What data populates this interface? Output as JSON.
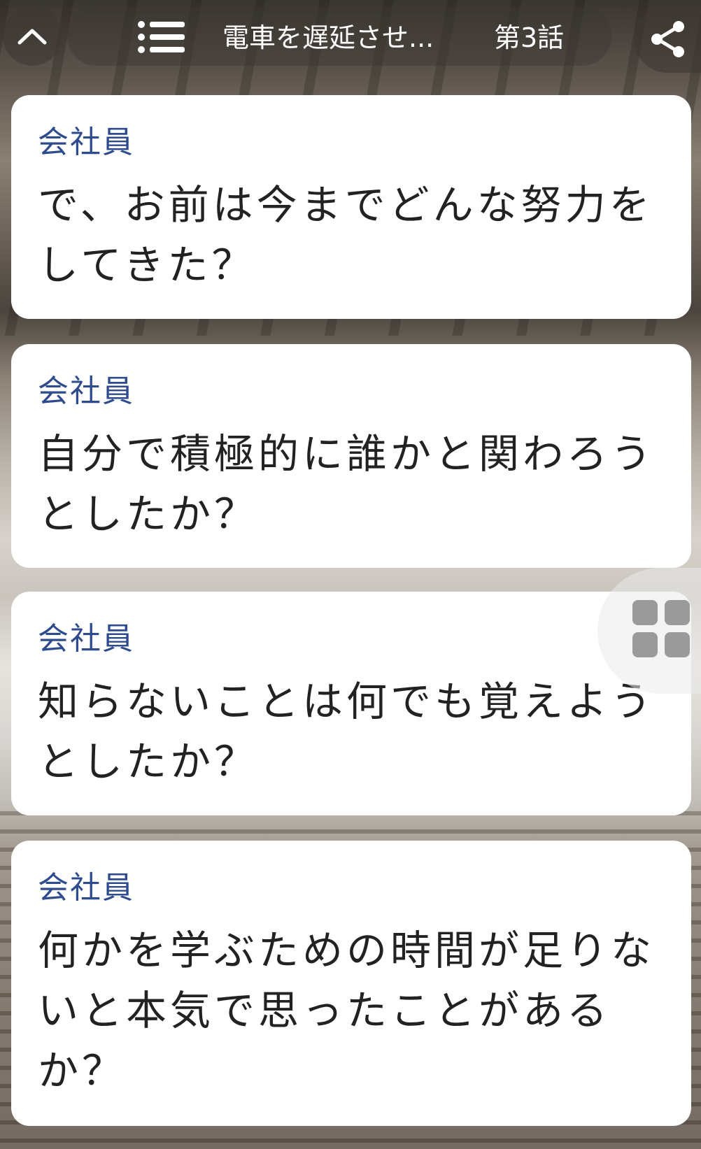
{
  "header": {
    "back_icon": "chevron-up-icon",
    "menu_icon": "list-icon",
    "title": "電車を遅延させ...",
    "episode": "第3話",
    "share_icon": "share-icon"
  },
  "colors": {
    "speaker": "#2e4c8d",
    "message_text": "#222222",
    "card_bg": "#ffffff",
    "header_pill": "rgba(60,55,50,0.45)"
  },
  "messages": [
    {
      "speaker": "会社員",
      "text": "で、お前は今までどんな努力を\nしてきた？"
    },
    {
      "speaker": "会社員",
      "text": "自分で積極的に誰かと関わろう\nとしたか？"
    },
    {
      "speaker": "会社員",
      "text": "知らないことは何でも覚えよう\nとしたか？"
    },
    {
      "speaker": "会社員",
      "text": "何かを学ぶための時間が足りな\nいと本気で思ったことがある\nか？"
    }
  ],
  "floating": {
    "grid_icon": "grid-icon"
  }
}
